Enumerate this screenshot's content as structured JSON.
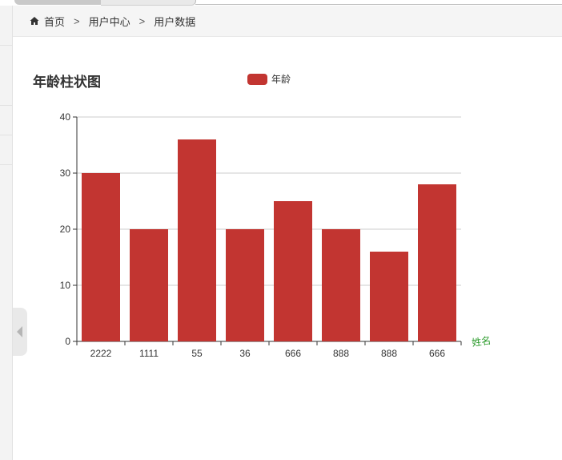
{
  "breadcrumb": {
    "items": [
      "首页",
      "用户中心",
      "用户数据"
    ],
    "separator": ">"
  },
  "colors": {
    "bar": "#c23531",
    "axis_name": "#2a9a2a"
  },
  "chart_data": {
    "type": "bar",
    "title": "年龄柱状图",
    "legend": [
      "年龄"
    ],
    "legend_position": "top-center",
    "xlabel": "姓名",
    "ylabel": "",
    "categories": [
      "2222",
      "1111",
      "55",
      "36",
      "666",
      "888",
      "888",
      "666"
    ],
    "series": [
      {
        "name": "年龄",
        "values": [
          30,
          20,
          36,
          20,
          25,
          20,
          16,
          28
        ]
      }
    ],
    "ylim": [
      0,
      40
    ],
    "yticks": [
      "0",
      "10",
      "20",
      "30",
      "40"
    ],
    "grid": true
  }
}
